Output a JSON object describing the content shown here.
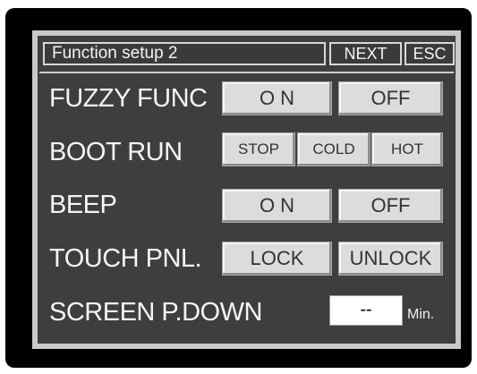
{
  "header": {
    "title": "Function setup 2",
    "next_label": "NEXT",
    "esc_label": "ESC"
  },
  "rows": {
    "fuzzy": {
      "label": "FUZZY FUNC",
      "on_label": "O N",
      "off_label": "OFF"
    },
    "boot_run": {
      "label": "BOOT RUN",
      "stop_label": "STOP",
      "cold_label": "COLD",
      "hot_label": "HOT"
    },
    "beep": {
      "label": "BEEP",
      "on_label": "O N",
      "off_label": "OFF"
    },
    "touch_panel": {
      "label": "TOUCH PNL.",
      "lock_label": "LOCK",
      "unlock_label": "UNLOCK"
    },
    "screen_power_down": {
      "label": "SCREEN P.DOWN",
      "value": "--",
      "unit": "Min."
    }
  },
  "colors": {
    "panel_background": "#3e3e3e",
    "button_face": "#dcdcdc",
    "label_text": "#f5f5f5"
  }
}
